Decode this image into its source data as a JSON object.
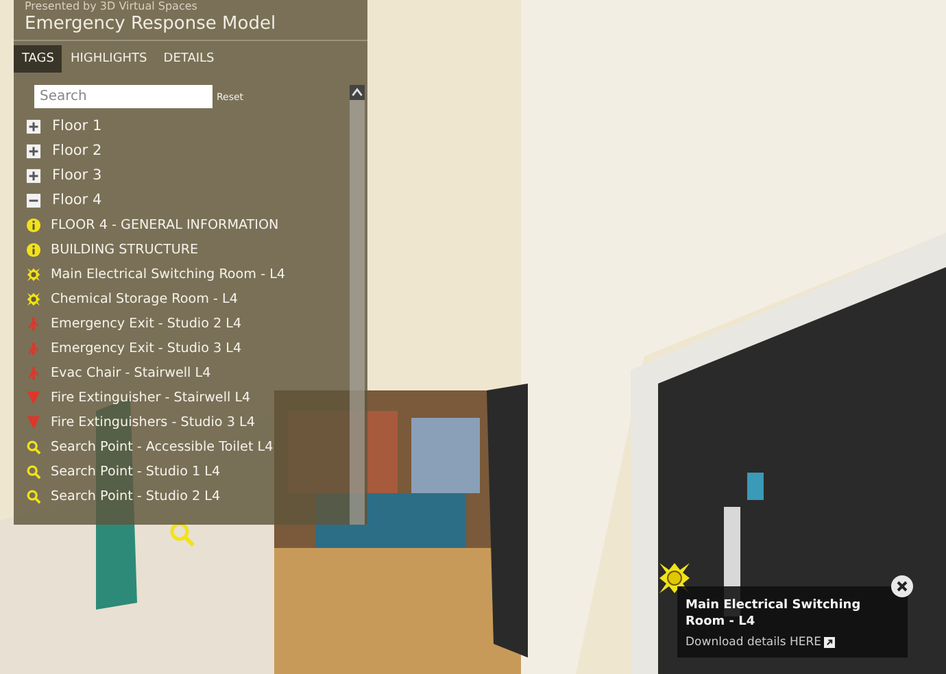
{
  "header": {
    "byline": "Presented by 3D Virtual Spaces",
    "title": "Emergency Response Model"
  },
  "tabs": [
    {
      "label": "TAGS",
      "selected": true
    },
    {
      "label": "HIGHLIGHTS",
      "selected": false
    },
    {
      "label": "DETAILS",
      "selected": false
    }
  ],
  "search": {
    "placeholder": "Search",
    "reset": "Reset"
  },
  "tree": [
    {
      "label": "Floor 1",
      "expanded": false
    },
    {
      "label": "Floor 2",
      "expanded": false
    },
    {
      "label": "Floor 3",
      "expanded": false
    },
    {
      "label": "Floor 4",
      "expanded": true,
      "children": [
        {
          "label": "FLOOR 4 - GENERAL INFORMATION",
          "kind": "info"
        },
        {
          "label": "BUILDING STRUCTURE",
          "kind": "info"
        },
        {
          "label": "Main Electrical Switching Room - L4",
          "kind": "hazard"
        },
        {
          "label": "Chemical Storage Room - L4",
          "kind": "hazard"
        },
        {
          "label": "Emergency Exit - Studio 2 L4",
          "kind": "exit"
        },
        {
          "label": "Emergency Exit - Studio 3 L4",
          "kind": "exit"
        },
        {
          "label": "Evac Chair - Stairwell L4",
          "kind": "exit"
        },
        {
          "label": "Fire Extinguisher - Stairwell L4",
          "kind": "extinguisher"
        },
        {
          "label": "Fire Extinguishers - Studio 3 L4",
          "kind": "extinguisher"
        },
        {
          "label": "Search Point - Accessible Toilet L4",
          "kind": "search"
        },
        {
          "label": "Search Point - Studio 1 L4",
          "kind": "search"
        },
        {
          "label": "Search Point - Studio 2 L4",
          "kind": "search"
        }
      ]
    }
  ],
  "tooltip": {
    "title": "Main Electrical Switching Room - L4",
    "link": "Download details HERE"
  }
}
